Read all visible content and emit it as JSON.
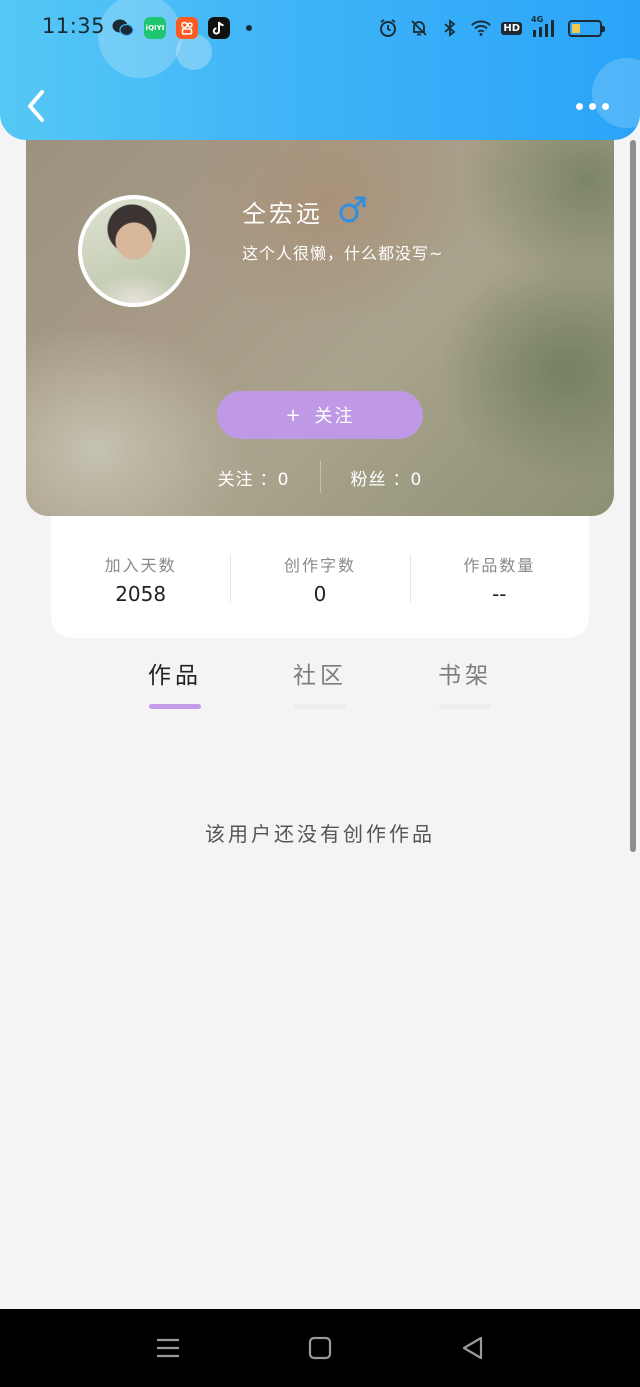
{
  "status_bar": {
    "time": "11:35",
    "app_icons": [
      "wechat-icon",
      "iqiyi-icon",
      "kuaishou-icon",
      "tiktok-icon"
    ],
    "iqiyi_label": "iQIYI",
    "system_icons": [
      "alarm-icon",
      "mute-icon",
      "bluetooth-icon",
      "wifi-icon",
      "hd-icon",
      "signal-4g-icon",
      "battery-icon"
    ],
    "hd_label": "HD",
    "network_label": "4G",
    "battery_level": 0.3
  },
  "nav": {
    "back_icon": "chevron-left-icon",
    "more_icon": "more-dots-icon"
  },
  "profile": {
    "name": "仝宏远",
    "gender_icon": "male-symbol-icon",
    "bio": "这个人很懒，什么都没写~",
    "follow_plus": "+",
    "follow_label": "关注",
    "following_label": "关注",
    "following_count": "：0",
    "followers_label": "粉丝",
    "followers_count": "：0"
  },
  "info": {
    "days_label": "加入天数",
    "days_value": "2058",
    "words_label": "创作字数",
    "words_value": "0",
    "works_label": "作品数量",
    "works_value": "--"
  },
  "tabs": [
    {
      "label": "作品",
      "active": true
    },
    {
      "label": "社区",
      "active": false
    },
    {
      "label": "书架",
      "active": false
    }
  ],
  "empty_message": "该用户还没有创作作品",
  "colors": {
    "header_start": "#56c8f5",
    "header_end": "#2aa4f8",
    "follow_button": "#bf99e6",
    "tab_indicator": "#c39be6",
    "gender_icon": "#2f8fe0"
  },
  "system_nav": [
    "menu-icon",
    "home-icon",
    "back-triangle-icon"
  ]
}
